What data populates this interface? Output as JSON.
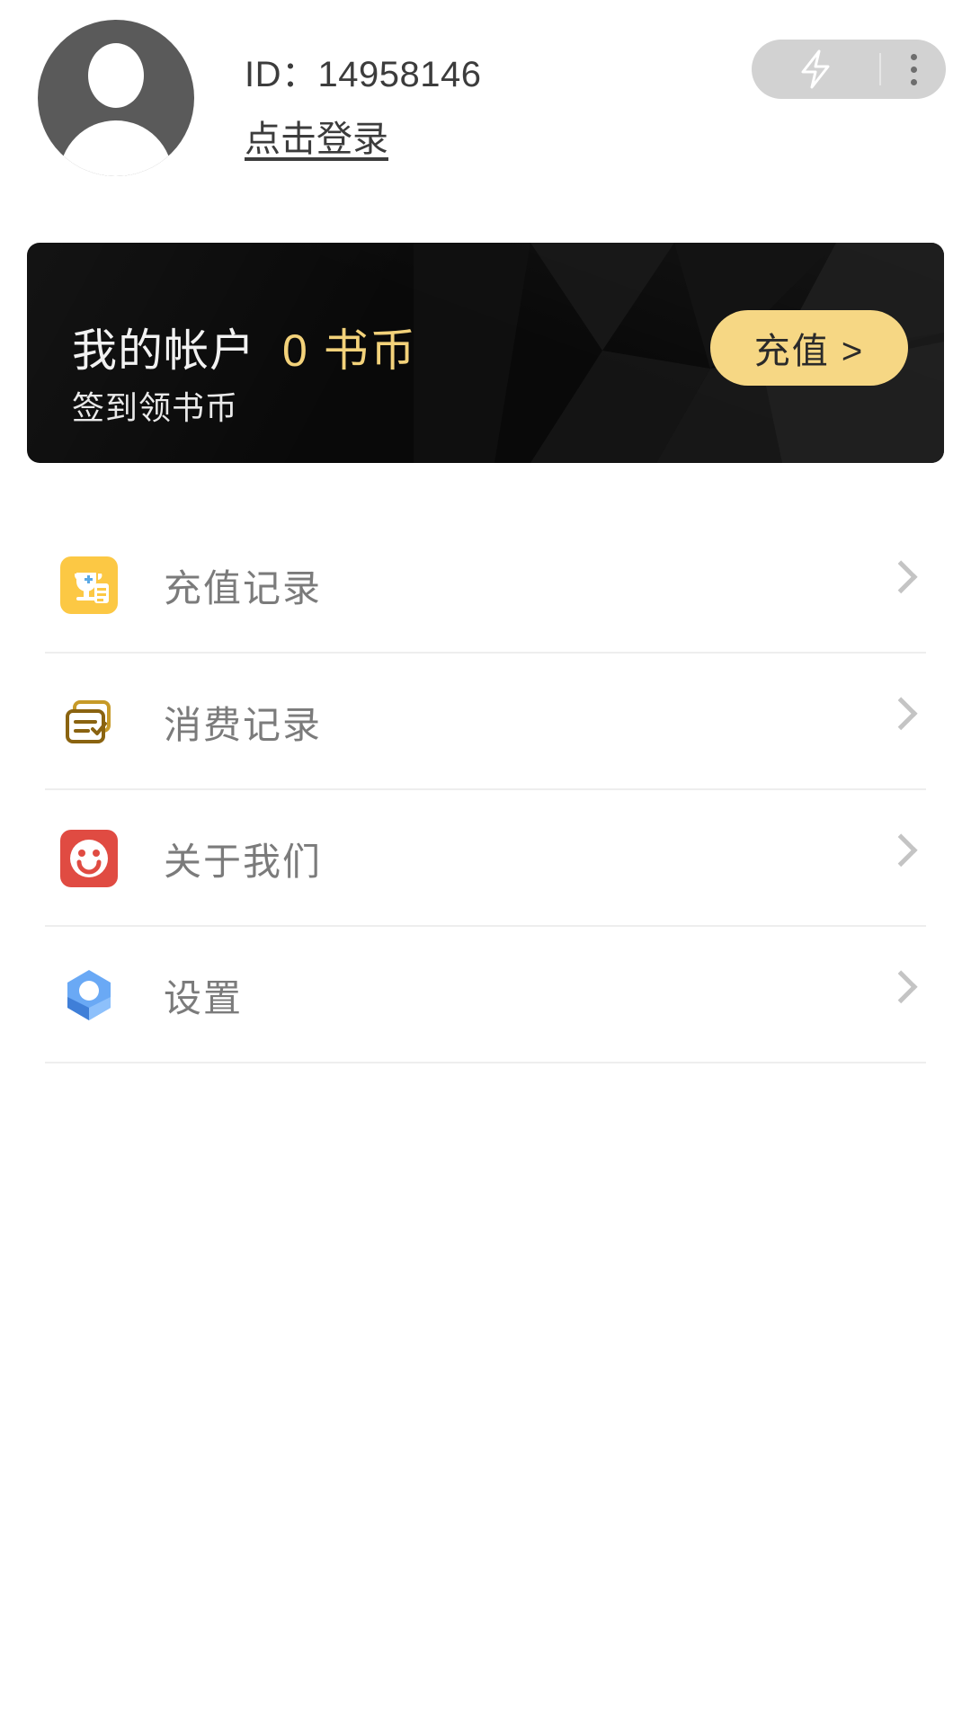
{
  "header": {
    "avatar_name": "default-user-avatar",
    "id_label": "ID：14958146",
    "login_link": "点击登录",
    "flash_icon": "flash-icon",
    "more_icon": "three-dot-menu-icon"
  },
  "banner": {
    "title": "我的帐户",
    "coins": "0 书币",
    "subtitle": "签到领书币",
    "recharge_label": "充值 >",
    "bg_color": "#090909",
    "gold_color": "#f3d27a",
    "button_color": "#f6d784"
  },
  "menu": {
    "items": [
      {
        "label": "充值记录",
        "icon": "recharge-record-icon",
        "icon_color": "#fcc844"
      },
      {
        "label": "消费记录",
        "icon": "consumption-record-icon",
        "icon_color": "#9b7414"
      },
      {
        "label": "关于我们",
        "icon": "about-us-smiley-icon",
        "icon_color": "#e04b42"
      },
      {
        "label": "设置",
        "icon": "settings-cube-icon",
        "icon_color": "#5b9bf0"
      }
    ],
    "chevron_icon": "chevron-right-icon"
  }
}
